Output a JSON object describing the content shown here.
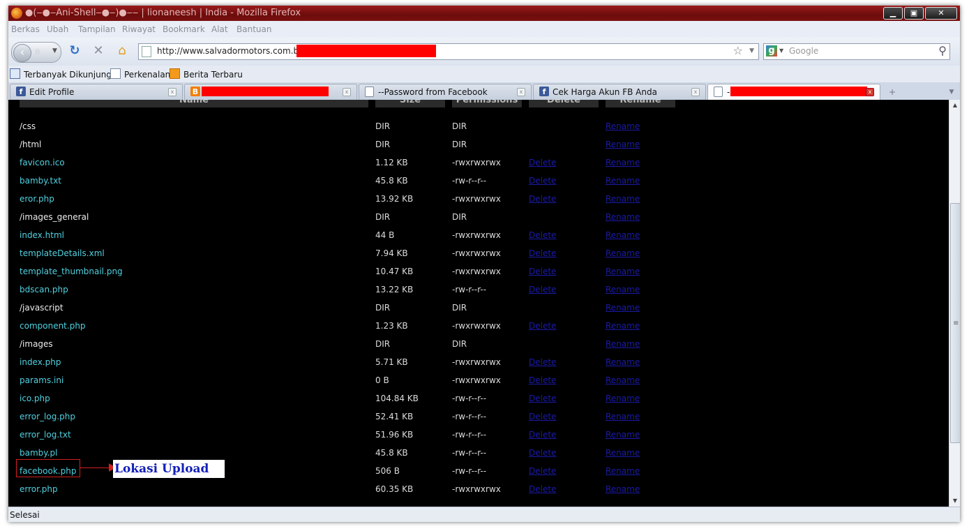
{
  "window": {
    "title": "●(‒●‒Ani-Shell‒●‒)●‒‒ | lionaneesh | India - Mozilla Firefox",
    "controls": {
      "minimize": "▁",
      "maximize": "▣",
      "close": "✕"
    }
  },
  "menu": [
    "Berkas",
    "Ubah",
    "Tampilan",
    "Riwayat",
    "Bookmark",
    "Alat",
    "Bantuan"
  ],
  "navigation": {
    "url": "http://www.salvadormotors.com.br/",
    "search_placeholder": "Google",
    "search_engine_letter": "g"
  },
  "bookmarks": [
    "Terbanyak Dikunjungi",
    "Perkenalan",
    "Berita Terbaru"
  ],
  "tabs": [
    {
      "label": "Edit Profile",
      "favicon": "f"
    },
    {
      "label": "",
      "favicon": "B"
    },
    {
      "label": "--Password from Facebook",
      "favicon": ""
    },
    {
      "label": "Cek Harga Akun FB Anda",
      "favicon": "f"
    },
    {
      "label": "-",
      "favicon": ""
    }
  ],
  "file_table": {
    "headers": [
      "Name",
      "Size",
      "Permissions",
      "Delete",
      "Rename"
    ],
    "rows": [
      {
        "name": "/css",
        "size": "DIR",
        "perms": "DIR",
        "delete": "",
        "rename": "Rename",
        "type": "dir"
      },
      {
        "name": "/html",
        "size": "DIR",
        "perms": "DIR",
        "delete": "",
        "rename": "Rename",
        "type": "dir"
      },
      {
        "name": "favicon.ico",
        "size": "1.12 KB",
        "perms": "-rwxrwxrwx",
        "delete": "Delete",
        "rename": "Rename",
        "type": "file"
      },
      {
        "name": "bamby.txt",
        "size": "45.8 KB",
        "perms": "-rw-r--r--",
        "delete": "Delete",
        "rename": "Rename",
        "type": "file"
      },
      {
        "name": "eror.php",
        "size": "13.92 KB",
        "perms": "-rwxrwxrwx",
        "delete": "Delete",
        "rename": "Rename",
        "type": "file"
      },
      {
        "name": "/images_general",
        "size": "DIR",
        "perms": "DIR",
        "delete": "",
        "rename": "Rename",
        "type": "dir"
      },
      {
        "name": "index.html",
        "size": "44 B",
        "perms": "-rwxrwxrwx",
        "delete": "Delete",
        "rename": "Rename",
        "type": "file"
      },
      {
        "name": "templateDetails.xml",
        "size": "7.94 KB",
        "perms": "-rwxrwxrwx",
        "delete": "Delete",
        "rename": "Rename",
        "type": "file"
      },
      {
        "name": "template_thumbnail.png",
        "size": "10.47 KB",
        "perms": "-rwxrwxrwx",
        "delete": "Delete",
        "rename": "Rename",
        "type": "file"
      },
      {
        "name": "bdscan.php",
        "size": "13.22 KB",
        "perms": "-rw-r--r--",
        "delete": "Delete",
        "rename": "Rename",
        "type": "file"
      },
      {
        "name": "/javascript",
        "size": "DIR",
        "perms": "DIR",
        "delete": "",
        "rename": "Rename",
        "type": "dir"
      },
      {
        "name": "component.php",
        "size": "1.23 KB",
        "perms": "-rwxrwxrwx",
        "delete": "Delete",
        "rename": "Rename",
        "type": "file"
      },
      {
        "name": "/images",
        "size": "DIR",
        "perms": "DIR",
        "delete": "",
        "rename": "Rename",
        "type": "dir"
      },
      {
        "name": "index.php",
        "size": "5.71 KB",
        "perms": "-rwxrwxrwx",
        "delete": "Delete",
        "rename": "Rename",
        "type": "file"
      },
      {
        "name": "params.ini",
        "size": "0 B",
        "perms": "-rwxrwxrwx",
        "delete": "Delete",
        "rename": "Rename",
        "type": "file"
      },
      {
        "name": "ico.php",
        "size": "104.84 KB",
        "perms": "-rw-r--r--",
        "delete": "Delete",
        "rename": "Rename",
        "type": "file"
      },
      {
        "name": "error_log.php",
        "size": "52.41 KB",
        "perms": "-rw-r--r--",
        "delete": "Delete",
        "rename": "Rename",
        "type": "file"
      },
      {
        "name": "error_log.txt",
        "size": "51.96 KB",
        "perms": "-rw-r--r--",
        "delete": "Delete",
        "rename": "Rename",
        "type": "file"
      },
      {
        "name": "bamby.pl",
        "size": "45.8 KB",
        "perms": "-rw-r--r--",
        "delete": "Delete",
        "rename": "Rename",
        "type": "file"
      },
      {
        "name": "facebook.php",
        "size": "506 B",
        "perms": "-rw-r--r--",
        "delete": "Delete",
        "rename": "Rename",
        "type": "file"
      },
      {
        "name": "error.php",
        "size": "60.35 KB",
        "perms": "-rwxrwxrwx",
        "delete": "Delete",
        "rename": "Rename",
        "type": "file"
      }
    ]
  },
  "annotation": {
    "label": "Lokasi Upload",
    "color": "#d32020"
  },
  "status": {
    "text": "Selesai"
  },
  "colors": {
    "dir_name": "#ececec",
    "file_name": "#4fd1e0",
    "link": "#1b1ba8",
    "redaction": "#ff0000"
  }
}
